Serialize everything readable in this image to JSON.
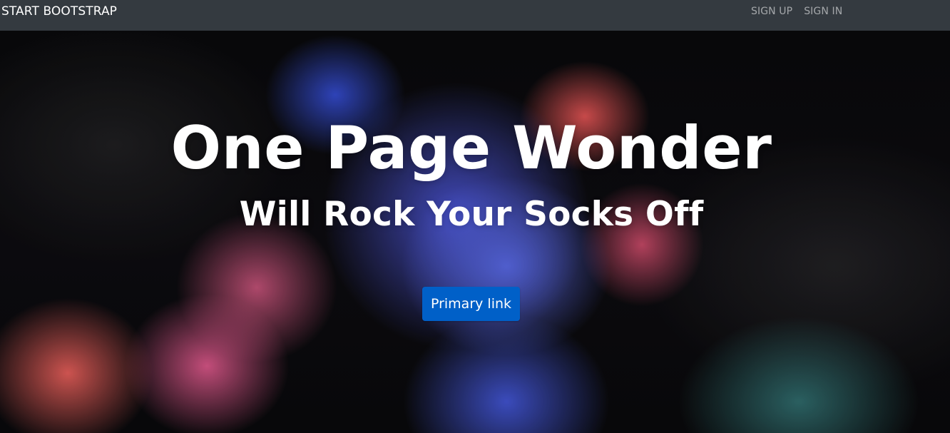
{
  "nav": {
    "brand": "START BOOTSTRAP",
    "links": [
      {
        "label": "SIGN UP"
      },
      {
        "label": "SIGN IN"
      }
    ]
  },
  "hero": {
    "title": "One Page Wonder",
    "subtitle": "Will Rock Your Socks Off",
    "button_label": "Primary link"
  },
  "colors": {
    "navbar_bg": "#343a40",
    "button_bg": "#0060c8",
    "nav_link_text": "rgba(255,255,255,0.55)"
  }
}
